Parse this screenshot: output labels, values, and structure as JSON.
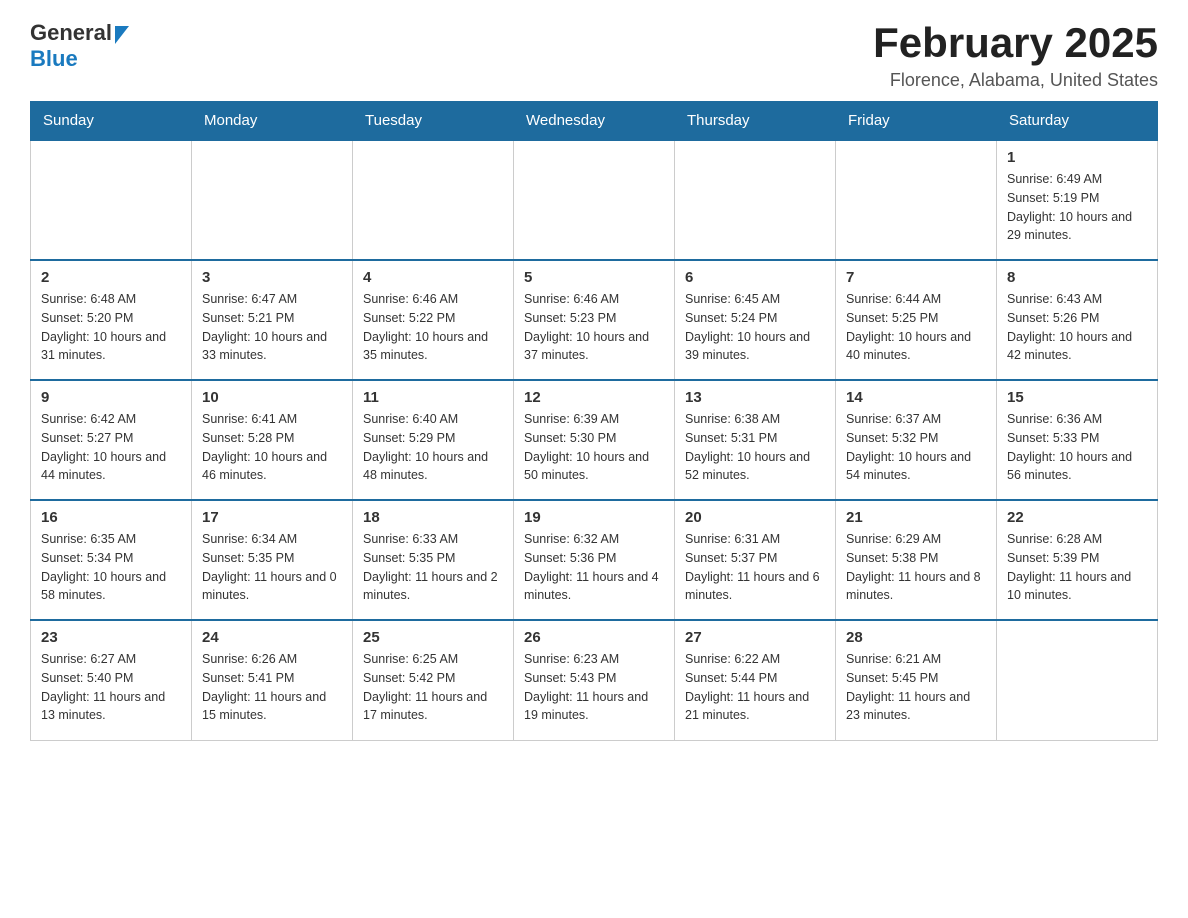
{
  "logo": {
    "text_general": "General",
    "text_blue": "Blue"
  },
  "title": "February 2025",
  "location": "Florence, Alabama, United States",
  "days_of_week": [
    "Sunday",
    "Monday",
    "Tuesday",
    "Wednesday",
    "Thursday",
    "Friday",
    "Saturday"
  ],
  "weeks": [
    [
      {
        "day": "",
        "info": ""
      },
      {
        "day": "",
        "info": ""
      },
      {
        "day": "",
        "info": ""
      },
      {
        "day": "",
        "info": ""
      },
      {
        "day": "",
        "info": ""
      },
      {
        "day": "",
        "info": ""
      },
      {
        "day": "1",
        "info": "Sunrise: 6:49 AM\nSunset: 5:19 PM\nDaylight: 10 hours and 29 minutes."
      }
    ],
    [
      {
        "day": "2",
        "info": "Sunrise: 6:48 AM\nSunset: 5:20 PM\nDaylight: 10 hours and 31 minutes."
      },
      {
        "day": "3",
        "info": "Sunrise: 6:47 AM\nSunset: 5:21 PM\nDaylight: 10 hours and 33 minutes."
      },
      {
        "day": "4",
        "info": "Sunrise: 6:46 AM\nSunset: 5:22 PM\nDaylight: 10 hours and 35 minutes."
      },
      {
        "day": "5",
        "info": "Sunrise: 6:46 AM\nSunset: 5:23 PM\nDaylight: 10 hours and 37 minutes."
      },
      {
        "day": "6",
        "info": "Sunrise: 6:45 AM\nSunset: 5:24 PM\nDaylight: 10 hours and 39 minutes."
      },
      {
        "day": "7",
        "info": "Sunrise: 6:44 AM\nSunset: 5:25 PM\nDaylight: 10 hours and 40 minutes."
      },
      {
        "day": "8",
        "info": "Sunrise: 6:43 AM\nSunset: 5:26 PM\nDaylight: 10 hours and 42 minutes."
      }
    ],
    [
      {
        "day": "9",
        "info": "Sunrise: 6:42 AM\nSunset: 5:27 PM\nDaylight: 10 hours and 44 minutes."
      },
      {
        "day": "10",
        "info": "Sunrise: 6:41 AM\nSunset: 5:28 PM\nDaylight: 10 hours and 46 minutes."
      },
      {
        "day": "11",
        "info": "Sunrise: 6:40 AM\nSunset: 5:29 PM\nDaylight: 10 hours and 48 minutes."
      },
      {
        "day": "12",
        "info": "Sunrise: 6:39 AM\nSunset: 5:30 PM\nDaylight: 10 hours and 50 minutes."
      },
      {
        "day": "13",
        "info": "Sunrise: 6:38 AM\nSunset: 5:31 PM\nDaylight: 10 hours and 52 minutes."
      },
      {
        "day": "14",
        "info": "Sunrise: 6:37 AM\nSunset: 5:32 PM\nDaylight: 10 hours and 54 minutes."
      },
      {
        "day": "15",
        "info": "Sunrise: 6:36 AM\nSunset: 5:33 PM\nDaylight: 10 hours and 56 minutes."
      }
    ],
    [
      {
        "day": "16",
        "info": "Sunrise: 6:35 AM\nSunset: 5:34 PM\nDaylight: 10 hours and 58 minutes."
      },
      {
        "day": "17",
        "info": "Sunrise: 6:34 AM\nSunset: 5:35 PM\nDaylight: 11 hours and 0 minutes."
      },
      {
        "day": "18",
        "info": "Sunrise: 6:33 AM\nSunset: 5:35 PM\nDaylight: 11 hours and 2 minutes."
      },
      {
        "day": "19",
        "info": "Sunrise: 6:32 AM\nSunset: 5:36 PM\nDaylight: 11 hours and 4 minutes."
      },
      {
        "day": "20",
        "info": "Sunrise: 6:31 AM\nSunset: 5:37 PM\nDaylight: 11 hours and 6 minutes."
      },
      {
        "day": "21",
        "info": "Sunrise: 6:29 AM\nSunset: 5:38 PM\nDaylight: 11 hours and 8 minutes."
      },
      {
        "day": "22",
        "info": "Sunrise: 6:28 AM\nSunset: 5:39 PM\nDaylight: 11 hours and 10 minutes."
      }
    ],
    [
      {
        "day": "23",
        "info": "Sunrise: 6:27 AM\nSunset: 5:40 PM\nDaylight: 11 hours and 13 minutes."
      },
      {
        "day": "24",
        "info": "Sunrise: 6:26 AM\nSunset: 5:41 PM\nDaylight: 11 hours and 15 minutes."
      },
      {
        "day": "25",
        "info": "Sunrise: 6:25 AM\nSunset: 5:42 PM\nDaylight: 11 hours and 17 minutes."
      },
      {
        "day": "26",
        "info": "Sunrise: 6:23 AM\nSunset: 5:43 PM\nDaylight: 11 hours and 19 minutes."
      },
      {
        "day": "27",
        "info": "Sunrise: 6:22 AM\nSunset: 5:44 PM\nDaylight: 11 hours and 21 minutes."
      },
      {
        "day": "28",
        "info": "Sunrise: 6:21 AM\nSunset: 5:45 PM\nDaylight: 11 hours and 23 minutes."
      },
      {
        "day": "",
        "info": ""
      }
    ]
  ]
}
